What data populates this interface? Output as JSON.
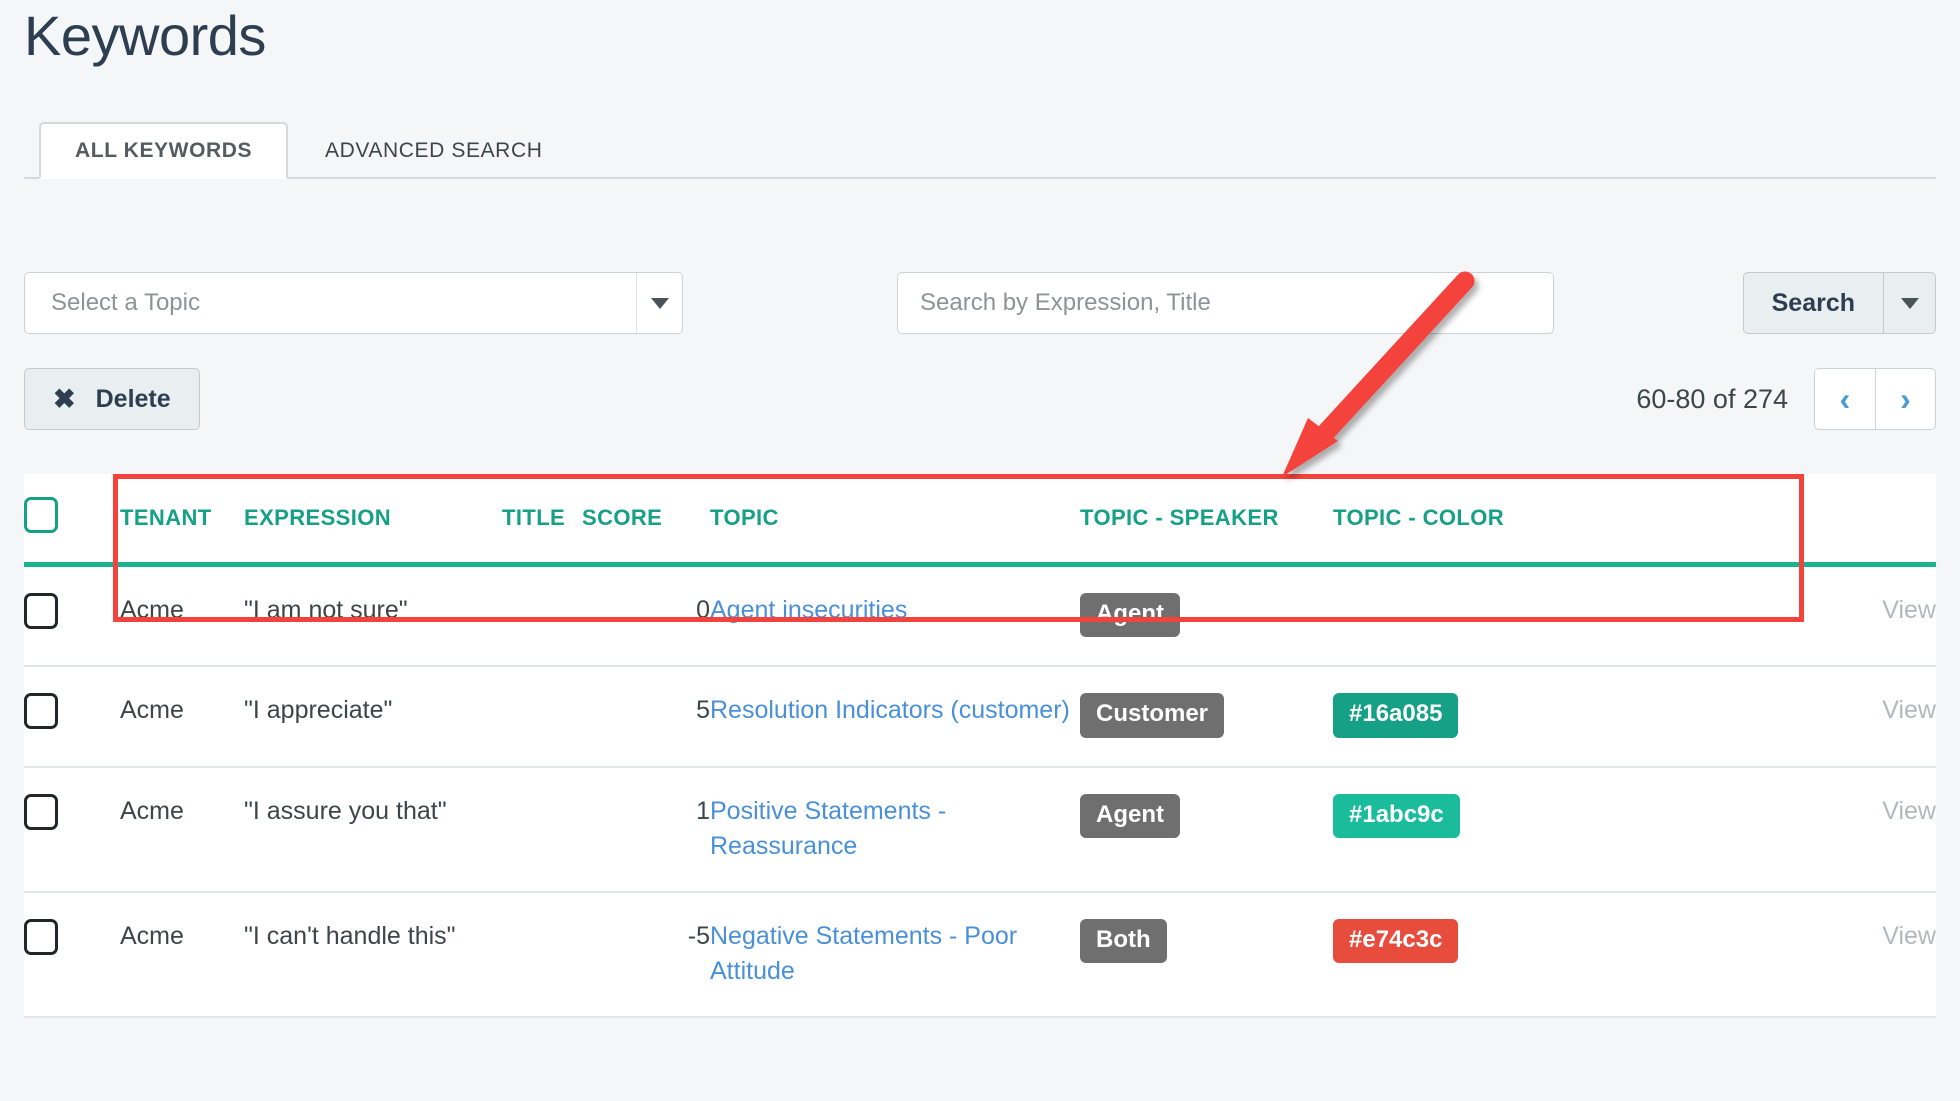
{
  "page": {
    "title": "Keywords"
  },
  "tabs": [
    {
      "label": "ALL KEYWORDS",
      "active": true
    },
    {
      "label": "ADVANCED SEARCH",
      "active": false
    }
  ],
  "filters": {
    "topic_select_placeholder": "Select a Topic",
    "topic_select_value": "",
    "search_placeholder": "Search by Expression, Title",
    "search_value": "",
    "search_button_label": "Search",
    "search_caret_icon": "caret-down-icon",
    "topic_caret_icon": "caret-down-icon"
  },
  "actions": {
    "delete_label": "Delete",
    "delete_icon": "x-icon"
  },
  "pagination": {
    "range_label": "60-80 of 274",
    "prev_icon": "chevron-left-icon",
    "next_icon": "chevron-right-icon",
    "prev_glyph": "‹",
    "next_glyph": "›"
  },
  "table": {
    "headers": {
      "select_all": "",
      "tenant": "TENANT",
      "expression": "EXPRESSION",
      "title": "TITLE",
      "score": "SCORE",
      "topic": "TOPIC",
      "topic_speaker": "TOPIC - SPEAKER",
      "topic_color": "TOPIC - COLOR",
      "actions": ""
    },
    "rows": [
      {
        "tenant": "Acme",
        "expression": "\"I am not sure\"",
        "title": "",
        "score": "0",
        "topic": "Agent insecurities",
        "speaker": "Agent",
        "color": "",
        "color_hex": "",
        "view": "View"
      },
      {
        "tenant": "Acme",
        "expression": "\"I appreciate\"",
        "title": "",
        "score": "5",
        "topic": "Resolution Indicators (customer)",
        "speaker": "Customer",
        "color": "#16a085",
        "color_hex": "#16a085",
        "view": "View"
      },
      {
        "tenant": "Acme",
        "expression": "\"I assure you that\"",
        "title": "",
        "score": "1",
        "topic": "Positive Statements - Reassurance",
        "speaker": "Agent",
        "color": "#1abc9c",
        "color_hex": "#1abc9c",
        "view": "View"
      },
      {
        "tenant": "Acme",
        "expression": "\"I can't handle this\"",
        "title": "",
        "score": "-5",
        "topic": "Negative Statements - Poor Attitude",
        "speaker": "Both",
        "color": "#e74c3c",
        "color_hex": "#e74c3c",
        "view": "View"
      }
    ]
  },
  "annotations": {
    "highlight_color": "#f4433c",
    "arrow_color": "#f4433c",
    "highlight_target": "table-header-row",
    "arrow_target": "table-header-row"
  },
  "theme": {
    "accent_teal": "#16a085",
    "link_blue": "#4a90d9",
    "badge_gray": "#6f6f6f",
    "page_bg": "#f5f6f7",
    "title_color": "#2c3e50"
  }
}
